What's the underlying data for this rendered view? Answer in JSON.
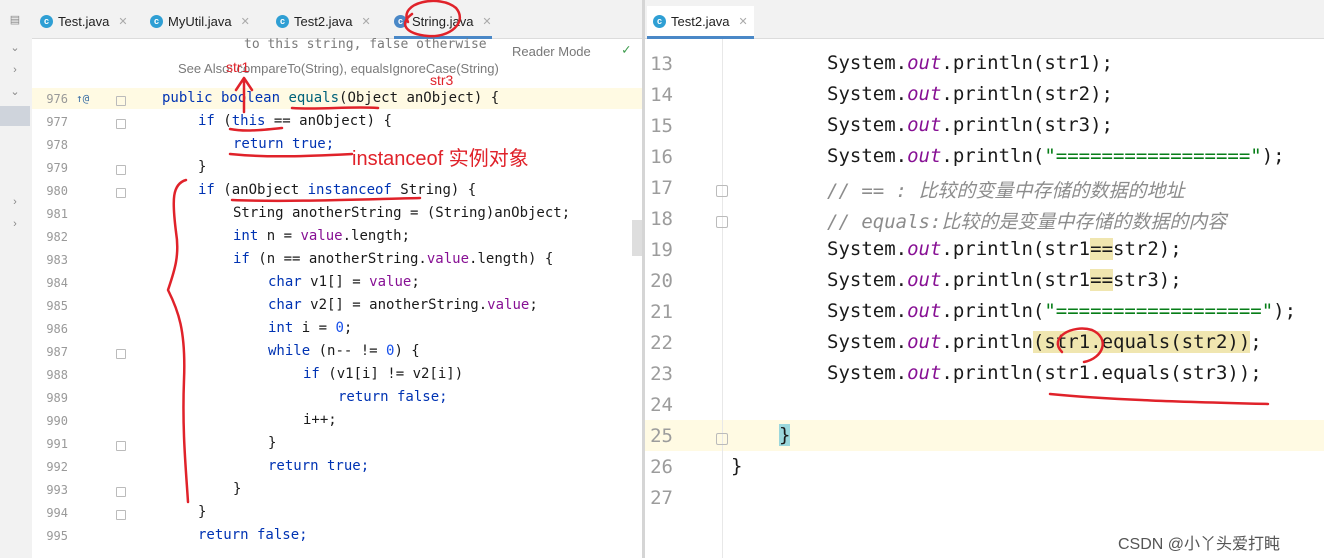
{
  "left_tabs": [
    "Test.java",
    "MyUtil.java",
    "Test2.java",
    "String.java"
  ],
  "right_tabs": [
    "Test2.java"
  ],
  "doc_popup": {
    "line1": "to this string, false otherwise",
    "line2": "See Also: compareTo(String), equalsIgnoreCase(String)",
    "reader_mode": "Reader Mode"
  },
  "left_line_numbers": [
    "976",
    "977",
    "978",
    "979",
    "980",
    "981",
    "982",
    "983",
    "984",
    "985",
    "986",
    "987",
    "988",
    "989",
    "990",
    "991",
    "992",
    "993",
    "994",
    "995"
  ],
  "left_code": {
    "l976": [
      "public boolean ",
      "equals",
      "(Object anObject) {"
    ],
    "l977": [
      "if",
      " (",
      "this",
      " == anObject) {"
    ],
    "l978": [
      "return true;"
    ],
    "l979": [
      "}"
    ],
    "l980": [
      "if",
      " (anObject ",
      "instanceof",
      " String) {"
    ],
    "l981": [
      "String anotherString = (String)anObject;"
    ],
    "l982": [
      "int",
      " n = ",
      "value",
      ".length;"
    ],
    "l983": [
      "if",
      " (n == anotherString.",
      "value",
      ".length) {"
    ],
    "l984": [
      "char",
      " v1[] = ",
      "value",
      ";"
    ],
    "l985": [
      "char",
      " v2[] = anotherString.",
      "value",
      ";"
    ],
    "l986": [
      "int",
      " i = ",
      "0",
      ";"
    ],
    "l987": [
      "while",
      " (n-- != ",
      "0",
      ") {"
    ],
    "l988": [
      "if",
      " (v1[i] != v2[i])"
    ],
    "l989": [
      "return false;"
    ],
    "l990": [
      "i++;"
    ],
    "l991": [
      "}"
    ],
    "l992": [
      "return true;"
    ],
    "l993": [
      "}"
    ],
    "l994": [
      "}"
    ],
    "l995": [
      "return false;"
    ]
  },
  "right_line_numbers": [
    "13",
    "14",
    "15",
    "16",
    "17",
    "18",
    "19",
    "20",
    "21",
    "22",
    "23",
    "24",
    "25",
    "26",
    "27"
  ],
  "right_code": {
    "r13": [
      "System.",
      "out",
      ".println(str1);"
    ],
    "r14": [
      "System.",
      "out",
      ".println(str2);"
    ],
    "r15": [
      "System.",
      "out",
      ".println(str3);"
    ],
    "r16": [
      "System.",
      "out",
      ".println(",
      "\"=================\"",
      ");"
    ],
    "r17": "// == : 比较的变量中存储的数据的地址",
    "r18": "// equals:比较的是变量中存储的数据的内容",
    "r19": [
      "System.",
      "out",
      ".println(str1",
      "==",
      "str2);"
    ],
    "r20": [
      "System.",
      "out",
      ".println(str1",
      "==",
      "str3);"
    ],
    "r21": [
      "System.",
      "out",
      ".println(",
      "\"==================\"",
      ");"
    ],
    "r22": [
      "System.",
      "out",
      ".println",
      "(",
      "str1.equals(str2)",
      ")",
      ";"
    ],
    "r23": [
      "System.",
      "out",
      ".println(str1.equals(str3));"
    ],
    "r25": "}",
    "r26": "}"
  },
  "annotations": {
    "str1": "str1",
    "str3": "str3",
    "instanceof_note": "instanceof 实例对象"
  },
  "watermark": "CSDN @小丫头爱打盹",
  "colors": {
    "annotation_red": "#e0222a",
    "keyword": "#0033b3",
    "field": "#871094"
  }
}
